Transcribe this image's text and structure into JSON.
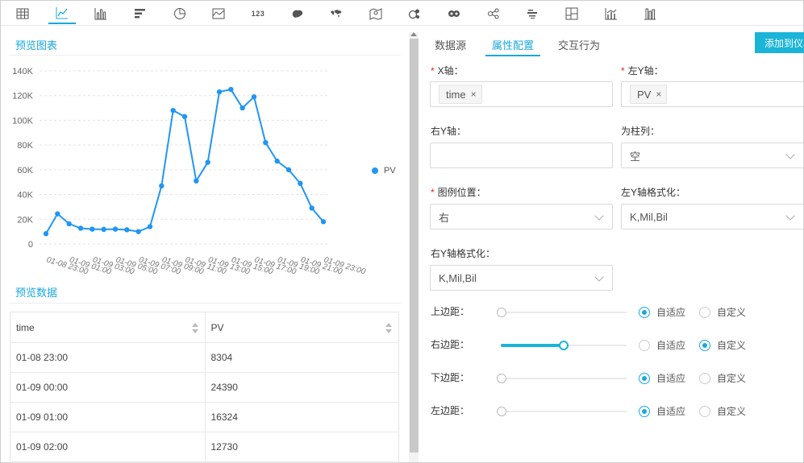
{
  "toolbar": {
    "icons": [
      "table-icon",
      "line-chart-icon",
      "bar-chart-icon",
      "horizontal-bar-icon",
      "pie-chart-icon",
      "area-chart-icon",
      "number-icon",
      "china-map-icon",
      "world-map-icon",
      "location-map-icon",
      "bubble-icon",
      "donut-icon",
      "graph-icon",
      "word-cloud-icon",
      "dashboard-layout-icon",
      "combo-chart-icon",
      "column-chart-icon"
    ],
    "number_label": "123",
    "active_index": 1
  },
  "preview_chart": {
    "title": "预览图表"
  },
  "preview_data": {
    "title": "预览数据",
    "columns": [
      "time",
      "PV"
    ],
    "rows": [
      [
        "01-08 23:00",
        "8304"
      ],
      [
        "01-09 00:00",
        "24390"
      ],
      [
        "01-09 01:00",
        "16324"
      ],
      [
        "01-09 02:00",
        "12730"
      ]
    ]
  },
  "chart_data": {
    "type": "line",
    "title": "",
    "xlabel": "",
    "ylabel": "",
    "ylim": [
      0,
      140000
    ],
    "yticks": [
      "0",
      "20K",
      "40K",
      "60K",
      "80K",
      "100K",
      "120K",
      "140K"
    ],
    "x": [
      "01-08 23:00",
      "01-09 00:00",
      "01-09 01:00",
      "01-09 02:00",
      "01-09 03:00",
      "01-09 04:00",
      "01-09 05:00",
      "01-09 06:00",
      "01-09 07:00",
      "01-09 08:00",
      "01-09 09:00",
      "01-09 10:00",
      "01-09 11:00",
      "01-09 12:00",
      "01-09 13:00",
      "01-09 14:00",
      "01-09 15:00",
      "01-09 16:00",
      "01-09 17:00",
      "01-09 18:00",
      "01-09 19:00",
      "01-09 20:00",
      "01-09 21:00",
      "01-09 22:00",
      "01-09 23:00"
    ],
    "xticks": [
      "01-08 23:00",
      "01-09 01:00",
      "01-09 03:00",
      "01-09 05:00",
      "01-09 07:00",
      "01-09 09:00",
      "01-09 11:00",
      "01-09 13:00",
      "01-09 15:00",
      "01-09 17:00",
      "01-09 19:00",
      "01-09 21:00",
      "01-09 23:00"
    ],
    "series": [
      {
        "name": "PV",
        "color": "#2196f3",
        "values": [
          8304,
          24390,
          16324,
          12730,
          12000,
          11800,
          12000,
          11500,
          10000,
          14000,
          47000,
          108000,
          103000,
          51000,
          66000,
          123000,
          125000,
          110000,
          119000,
          82000,
          67000,
          60000,
          49000,
          29000,
          18000
        ]
      }
    ],
    "legend_position": "right",
    "grid": "horizontal-dashed"
  },
  "tabs": [
    "数据源",
    "属性配置",
    "交互行为"
  ],
  "active_tab": 1,
  "add_button": "添加到仪表板",
  "form": {
    "x_axis": {
      "label": "X轴：",
      "tag": "time"
    },
    "left_y_axis": {
      "label": "左Y轴：",
      "tag": "PV"
    },
    "right_y_axis": {
      "label": "右Y轴：",
      "value": ""
    },
    "column_as": {
      "label": "为柱列：",
      "value": "空"
    },
    "legend_position": {
      "label": "图例位置：",
      "value": "右"
    },
    "left_y_format": {
      "label": "左Y轴格式化：",
      "value": "K,Mil,Bil"
    },
    "right_y_format": {
      "label": "右Y轴格式化：",
      "value": "K,Mil,Bil"
    }
  },
  "margins": [
    {
      "label": "上边距：",
      "slider_value": 0,
      "mode": "auto"
    },
    {
      "label": "右边距：",
      "slider_value": 0.5,
      "mode": "custom"
    },
    {
      "label": "下边距：",
      "slider_value": 0,
      "mode": "auto"
    },
    {
      "label": "左边距：",
      "slider_value": 0,
      "mode": "auto"
    }
  ],
  "margin_options": {
    "auto": "自适应",
    "custom": "自定义"
  },
  "colors": {
    "accent": "#1aa8e0",
    "button": "#1ab4d8",
    "line": "#2196f3",
    "required": "#e2231a"
  }
}
